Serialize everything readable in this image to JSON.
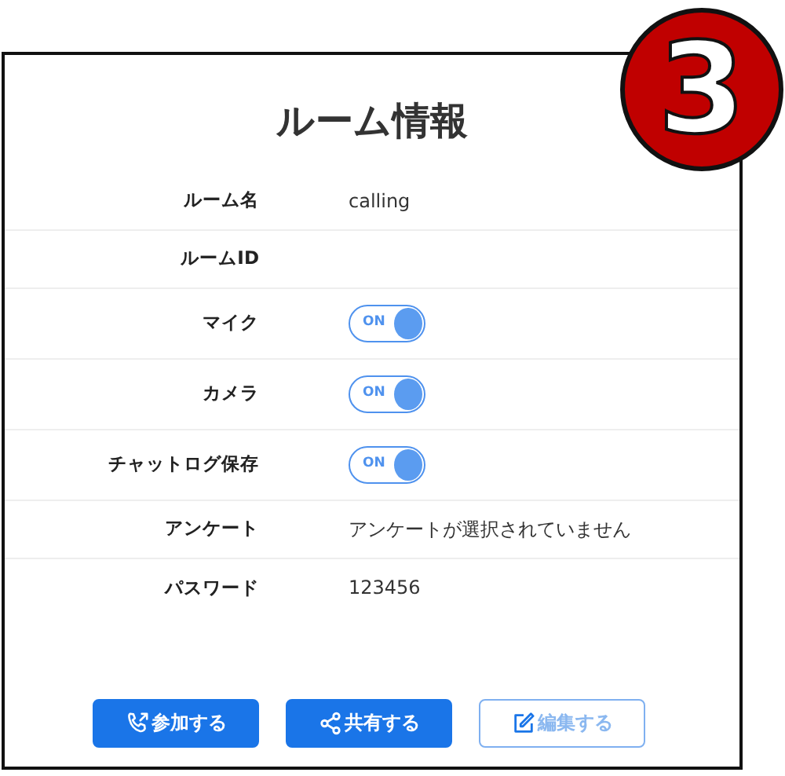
{
  "badge_number": "3",
  "title": "ルーム情報",
  "rows": [
    {
      "label": "ルーム名",
      "kind": "text",
      "value": "calling"
    },
    {
      "label": "ルームID",
      "kind": "text"
    },
    {
      "label": "マイク",
      "kind": "toggle",
      "on": true,
      "toggle_text": "ON"
    },
    {
      "label": "カメラ",
      "kind": "toggle",
      "on": true,
      "toggle_text": "ON"
    },
    {
      "label": "チャットログ保存",
      "kind": "toggle",
      "on": true,
      "toggle_text": "ON"
    },
    {
      "label": "アンケート",
      "kind": "text",
      "value": "アンケートが選択されていません"
    },
    {
      "label": "パスワード",
      "kind": "text",
      "value": "123456"
    }
  ],
  "buttons": [
    {
      "label": "参加する",
      "disabled": false
    },
    {
      "label": "共有する",
      "disabled": false
    },
    {
      "label": "編集する",
      "disabled": true
    }
  ]
}
